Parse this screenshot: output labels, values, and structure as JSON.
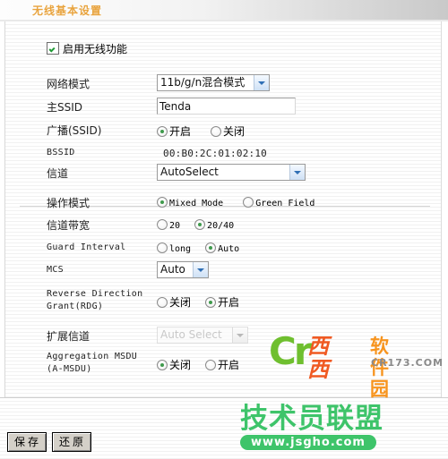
{
  "header": {
    "title": "无线基本设置"
  },
  "enable": {
    "label": "启用无线功能",
    "checked": true
  },
  "rows": {
    "network_mode": {
      "label": "网络模式",
      "value": "11b/g/n混合模式"
    },
    "main_ssid": {
      "label": "主SSID",
      "value": "Tenda"
    },
    "broadcast_ssid": {
      "label": "广播(SSID)",
      "option_on": "开启",
      "option_off": "关闭",
      "selected": "开启"
    },
    "bssid": {
      "label": "BSSID",
      "value": "00:B0:2C:01:02:10"
    },
    "channel": {
      "label": "信道",
      "value": "AutoSelect"
    },
    "operation_mode": {
      "label": "操作模式",
      "option_a": "Mixed Mode",
      "option_b": "Green Field",
      "selected": "Mixed Mode"
    },
    "channel_bandwidth": {
      "label": "信道带宽",
      "option_a": "20",
      "option_b": "20/40",
      "selected": "20/40"
    },
    "guard_interval": {
      "label": "Guard Interval",
      "option_a": "long",
      "option_b": "Auto",
      "selected": "Auto"
    },
    "mcs": {
      "label": "MCS",
      "value": "Auto"
    },
    "rdg": {
      "label_line1": "Reverse Direction",
      "label_line2": "Grant(RDG)",
      "option_a": "关闭",
      "option_b": "开启",
      "selected": "开启"
    },
    "extension_channel": {
      "label": "扩展信道",
      "value": "Auto Select",
      "disabled": true
    },
    "amsdu": {
      "label_line1": "Aggregation MSDU",
      "label_line2": "(A-MSDU)",
      "option_a": "关闭",
      "option_b": "开启",
      "selected": "关闭"
    }
  },
  "footer": {
    "save_label": "保存",
    "restore_label": "还原"
  },
  "watermarks": {
    "cr173": {
      "logo_mark": "Cr",
      "name_red": "西西",
      "name_orange": "软件园",
      "domain": "CR173.COM"
    },
    "jsgho": {
      "name": "技术员联盟",
      "domain": "www.jsgho.com"
    }
  },
  "colors": {
    "title": "#e8a33d",
    "radio_dot": "#3f9a4c",
    "check": "#1f9a35",
    "jsgho_green": "#3ec46a",
    "cr_green": "#6fbf2f",
    "cr_red": "#f05a23",
    "cr_orange": "#f7941e"
  }
}
